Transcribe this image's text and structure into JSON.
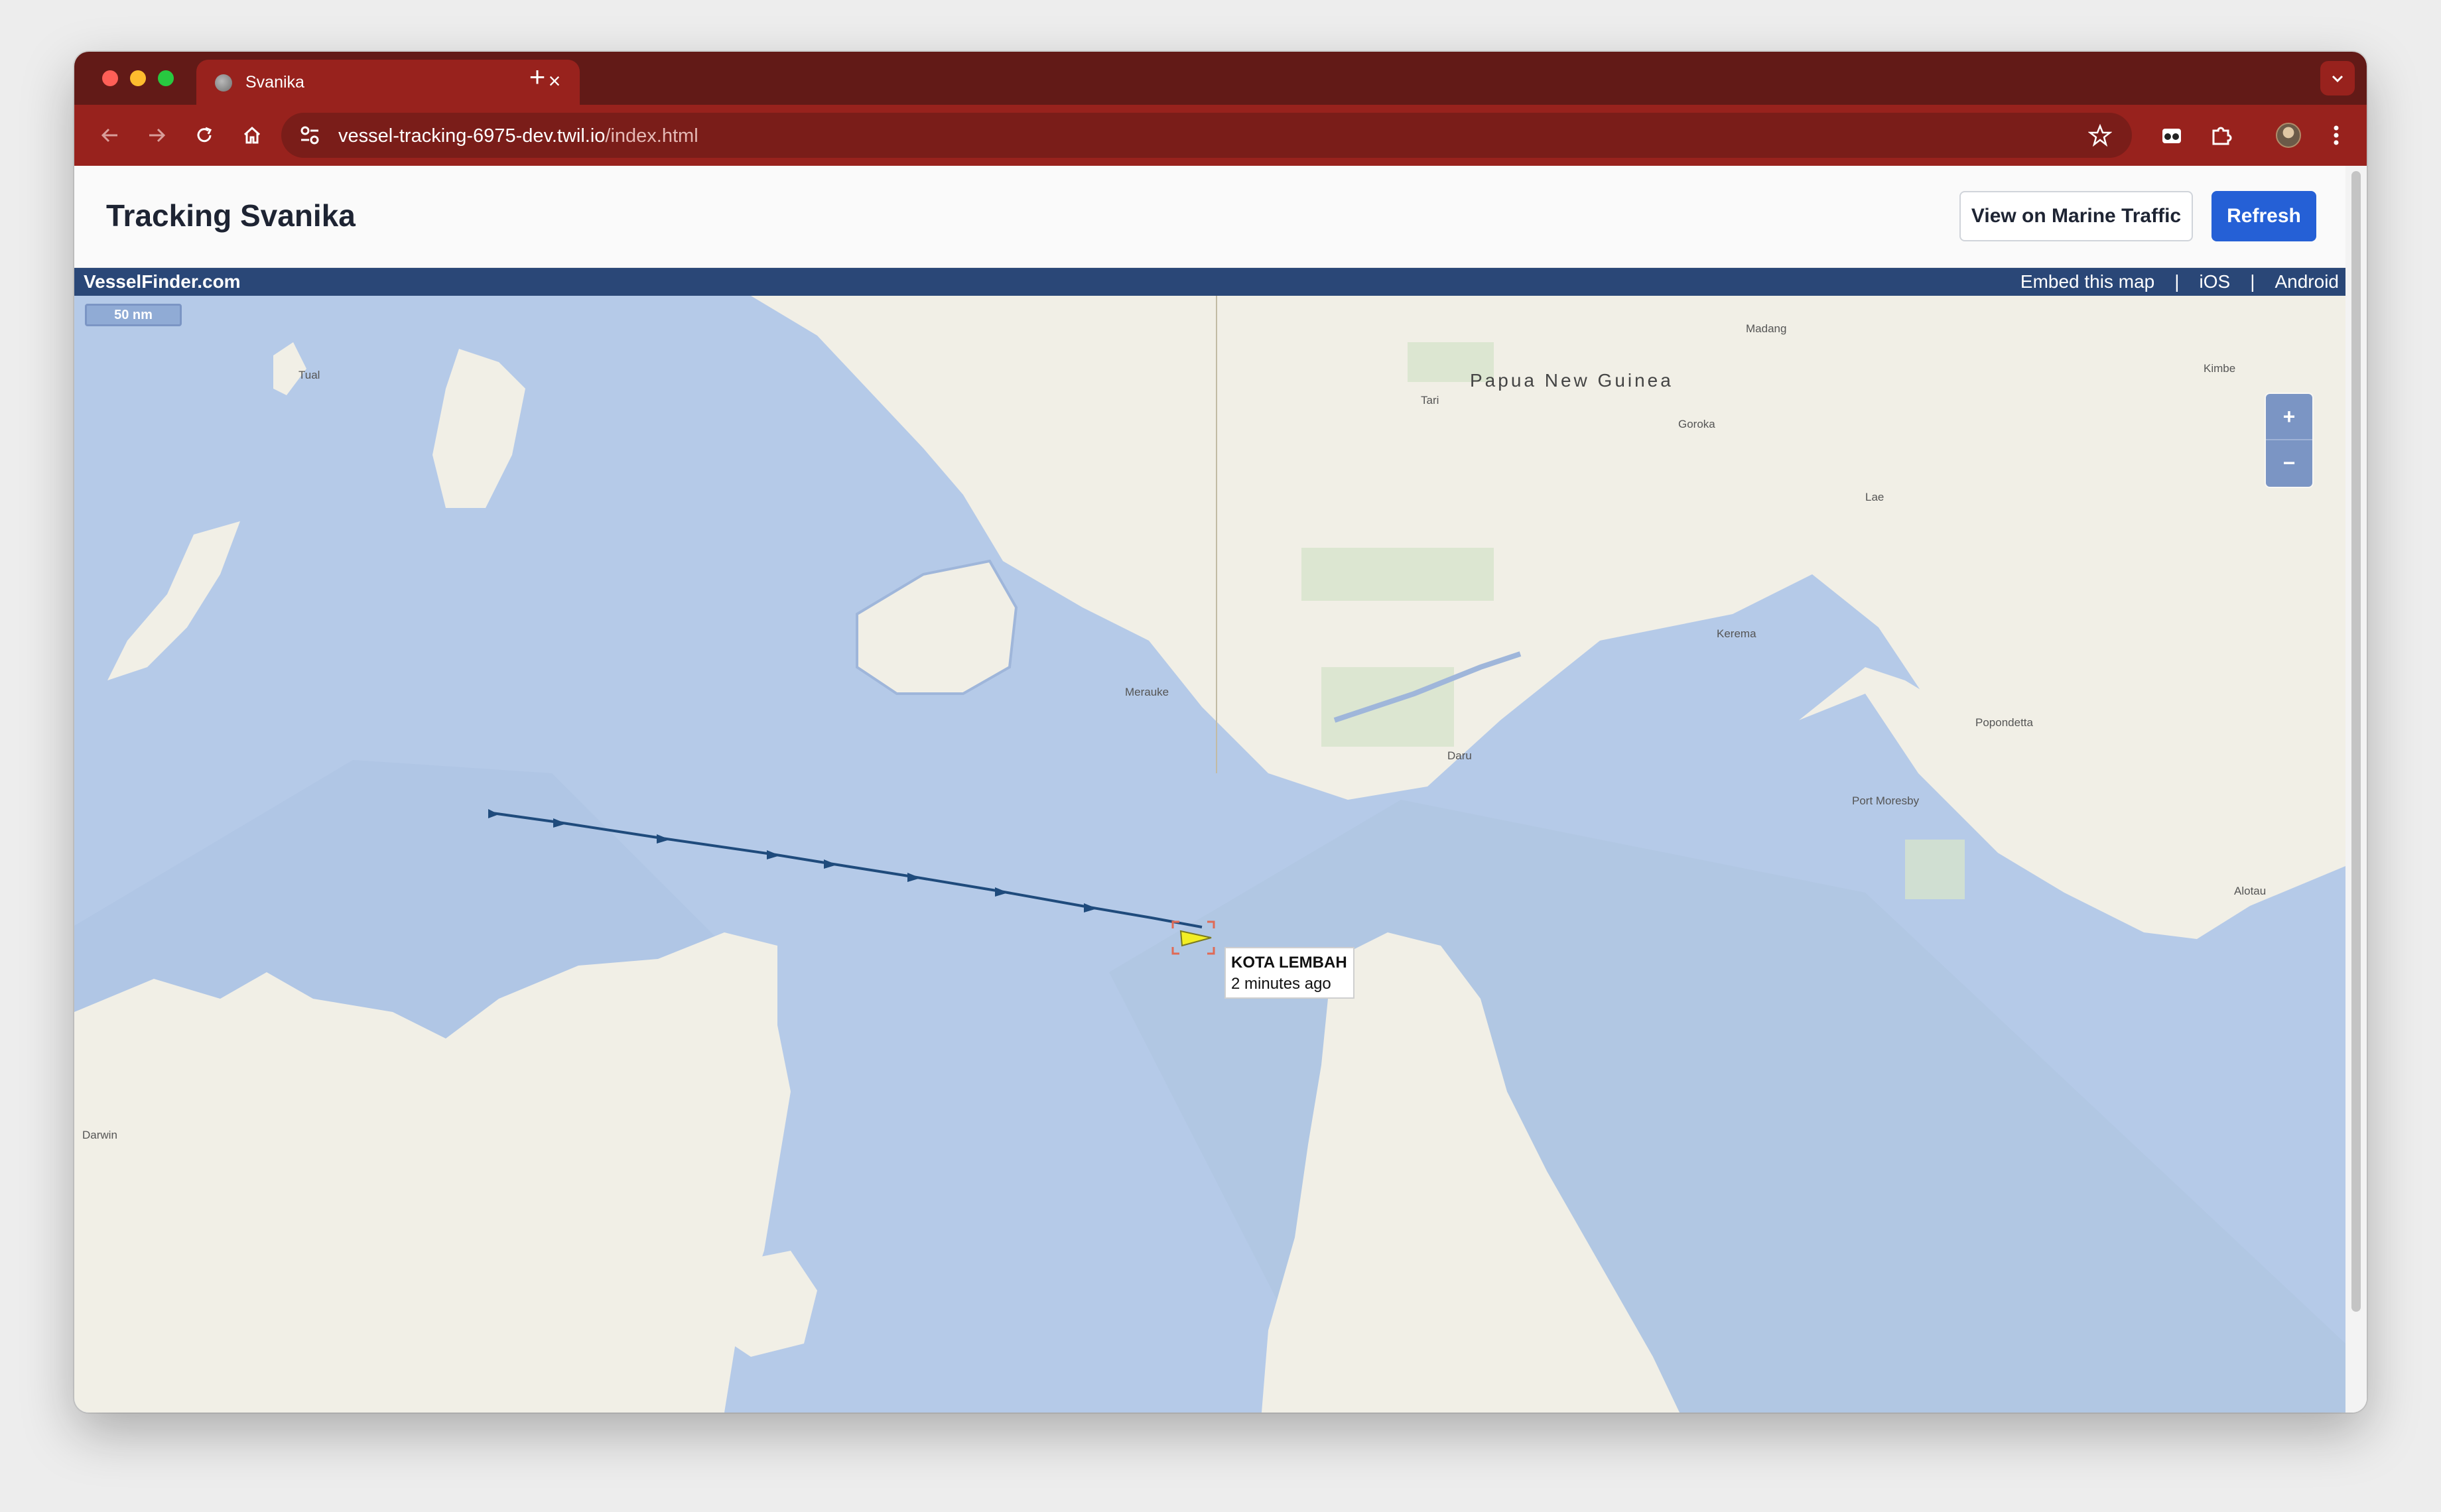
{
  "browser": {
    "tab_title": "Svanika",
    "tab_close": "×",
    "new_tab": "+",
    "url_host": "vessel-tracking-6975-dev.twil.io",
    "url_path": "/index.html"
  },
  "page": {
    "title": "Tracking Svanika",
    "marine_traffic_label": "View on Marine Traffic",
    "refresh_label": "Refresh"
  },
  "vesselfinder": {
    "brand": "VesselFinder.com",
    "embed_label": "Embed this map",
    "ios_label": "iOS",
    "android_label": "Android",
    "separator": "|"
  },
  "map": {
    "scale": "50 nm",
    "zoom_in": "+",
    "zoom_out": "−",
    "places": {
      "country": "Papua New Guinea",
      "madang": "Madang",
      "kimbe": "Kimbe",
      "tari": "Tari",
      "goroka": "Goroka",
      "lae": "Lae",
      "kerema": "Kerema",
      "merauke": "Merauke",
      "daru": "Daru",
      "popondetta": "Popondetta",
      "port_moresby": "Port Moresby",
      "alotau": "Alotau",
      "tual": "Tual",
      "darwin": "Darwin"
    },
    "vessel": {
      "name": "KOTA LEMBAH",
      "last_seen": "2 minutes ago"
    },
    "colors": {
      "sea": "#b5cae8",
      "land": "#f2f0e6",
      "track": "#1f4b7c"
    }
  }
}
